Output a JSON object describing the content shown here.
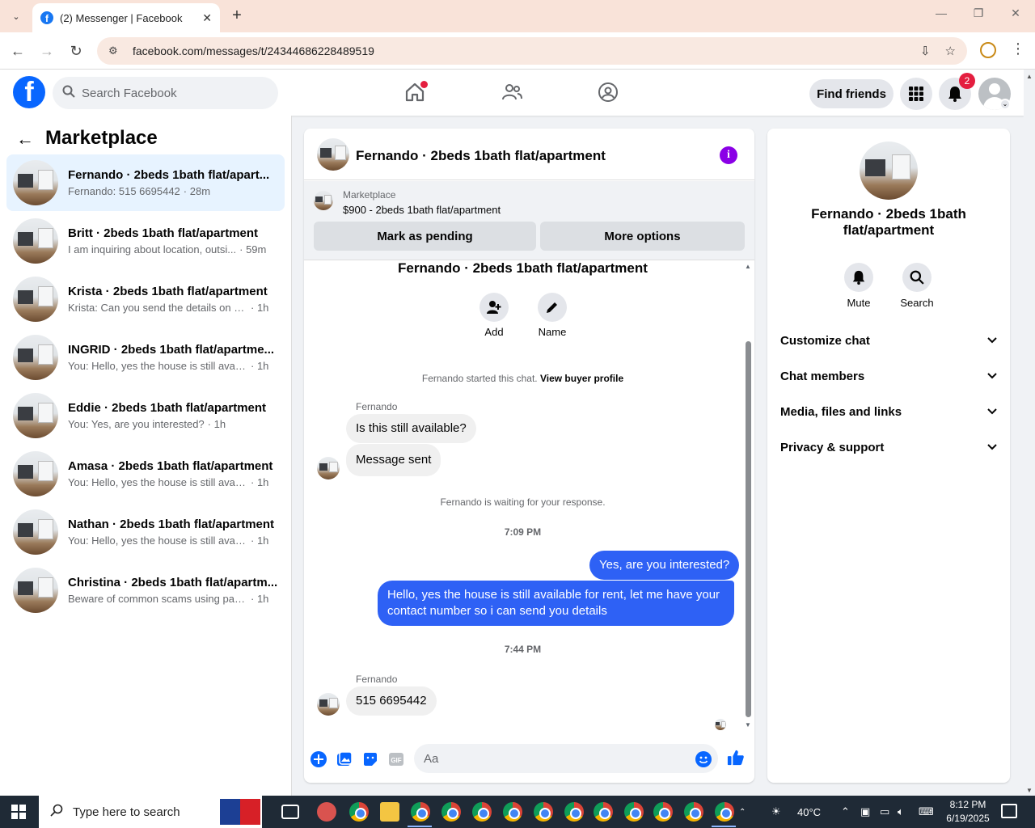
{
  "browser": {
    "tab_title": "(2) Messenger | Facebook",
    "url": "facebook.com/messages/t/24344686228489519"
  },
  "fb_header": {
    "search_placeholder": "Search Facebook",
    "find_friends_label": "Find friends",
    "notifications_count": "2"
  },
  "left_panel": {
    "title": "Marketplace",
    "conversations": [
      {
        "name": "Fernando · 2beds 1bath flat/apart...",
        "preview": "Fernando: 515 6695442",
        "time": "· 28m",
        "active": true
      },
      {
        "name": "Britt · 2beds 1bath flat/apartment",
        "preview": "I am inquiring about location, outsi...",
        "time": "· 59m"
      },
      {
        "name": "Krista · 2beds 1bath flat/apartment",
        "preview": "Krista: Can you send the details on he...",
        "time": "· 1h"
      },
      {
        "name": "INGRID · 2beds 1bath flat/apartme...",
        "preview": "You: Hello, yes the house is still availa...",
        "time": "· 1h"
      },
      {
        "name": "Eddie · 2beds 1bath flat/apartment",
        "preview": "You: Yes, are you interested?",
        "time": "· 1h"
      },
      {
        "name": "Amasa · 2beds 1bath flat/apartment",
        "preview": "You: Hello, yes the house is still availa...",
        "time": "· 1h"
      },
      {
        "name": "Nathan · 2beds 1bath flat/apartment",
        "preview": "You: Hello, yes the house is still availa...",
        "time": "· 1h"
      },
      {
        "name": "Christina · 2beds 1bath flat/apartm...",
        "preview": "Beware of common scams using pay...",
        "time": "· 1h"
      }
    ]
  },
  "chat": {
    "title": "Fernando · 2beds 1bath flat/apartment",
    "marketplace_label": "Marketplace",
    "listing": "$900 - 2beds 1bath flat/apartment",
    "mark_pending_label": "Mark as pending",
    "more_options_label": "More options",
    "intro_name": "Fernando · 2beds 1bath flat/apartment",
    "add_label": "Add",
    "name_label": "Name",
    "started_text": "Fernando started this chat.",
    "view_buyer_profile": "View buyer profile",
    "sender_1": "Fernando",
    "msg_in_1": "Is this still available?",
    "msg_in_2": "Message sent",
    "waiting_text": "Fernando is waiting for your response.",
    "time_1": "7:09 PM",
    "msg_out_1": "Yes, are you interested?",
    "msg_out_2": "Hello, yes the house is still available for rent, let me have your contact number so i can send you details",
    "time_2": "7:44 PM",
    "sender_2": "Fernando",
    "msg_in_3": "515 6695442",
    "composer_placeholder": "Aa"
  },
  "right_panel": {
    "name": "Fernando · 2beds 1bath flat/apartment",
    "mute_label": "Mute",
    "search_label": "Search",
    "sections": [
      "Customize chat",
      "Chat members",
      "Media, files and links",
      "Privacy & support"
    ]
  },
  "taskbar": {
    "search_placeholder": "Type here to search",
    "temperature": "40°C",
    "time": "8:12 PM",
    "date": "6/19/2025"
  },
  "colors": {
    "accent": "#0866ff",
    "outgoing_bubble": "#2e61f5",
    "active_conv": "#e7f3ff",
    "badge": "#e41e3f"
  }
}
